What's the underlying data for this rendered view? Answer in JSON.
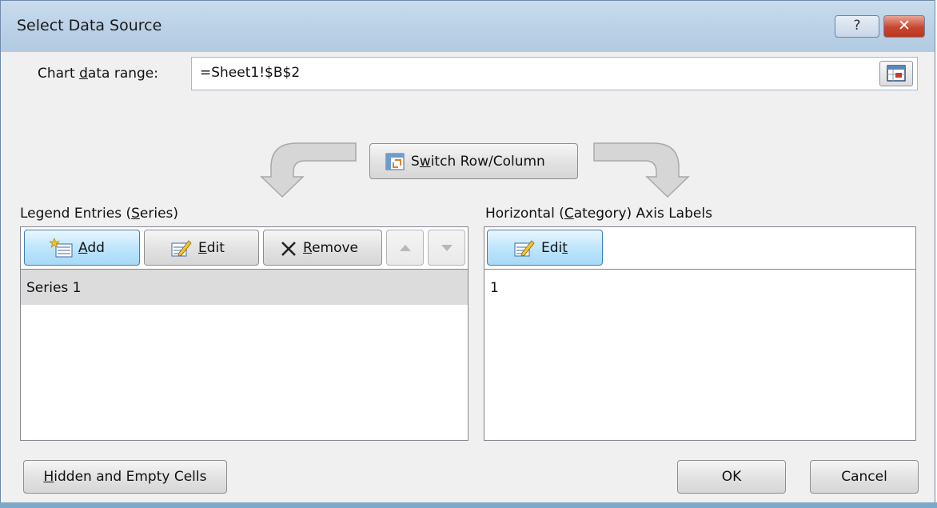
{
  "window": {
    "title": "Select Data Source",
    "help_glyph": "?",
    "close_glyph": "✕"
  },
  "range": {
    "label_pre": "Chart ",
    "label_ul": "d",
    "label_post": "ata range:",
    "value": "=Sheet1!$B$2"
  },
  "switch": {
    "ul": "w",
    "pre": "S",
    "post": "itch Row/Column"
  },
  "legend": {
    "heading_pre": "Legend Entries (",
    "heading_ul": "S",
    "heading_post": "eries)",
    "add": {
      "ul": "A",
      "post": "dd"
    },
    "edit": {
      "ul": "E",
      "post": "dit"
    },
    "remove": {
      "ul": "R",
      "post": "emove"
    },
    "items": [
      "Series 1"
    ]
  },
  "axis": {
    "heading_pre": "Horizontal (",
    "heading_ul": "C",
    "heading_post": "ategory) Axis Labels",
    "edit": {
      "pre": "Edi",
      "ul": "t"
    },
    "items": [
      "1"
    ]
  },
  "footer": {
    "hidden": {
      "ul": "H",
      "post": "idden and Empty Cells"
    },
    "ok": "OK",
    "cancel": "Cancel"
  },
  "colors": {
    "selected_row": "#dcdcdc",
    "focus_button": "#bee6fd",
    "titlebar": "#b9d0e6"
  }
}
